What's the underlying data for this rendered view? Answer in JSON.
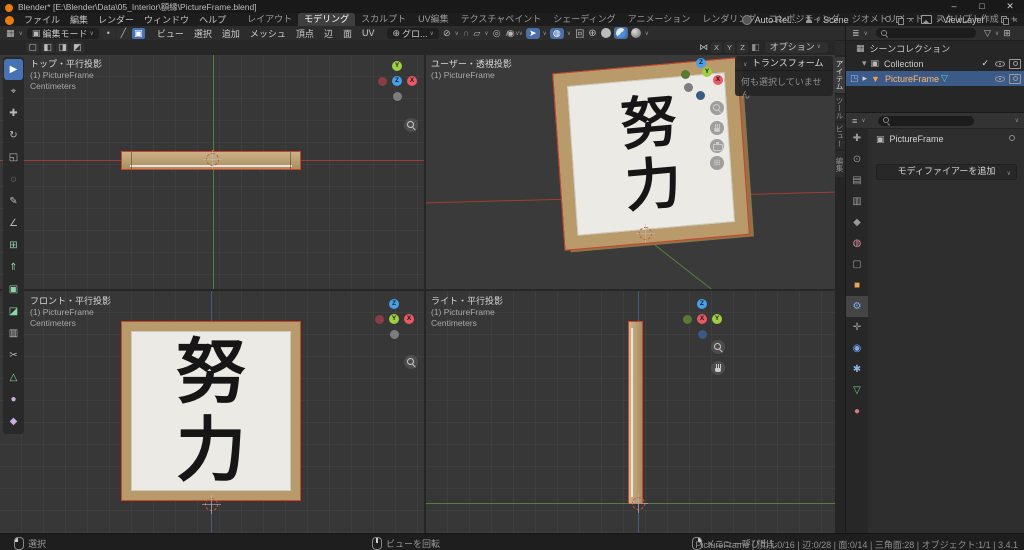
{
  "window": {
    "title": "Blender* [E:\\Blender\\Data\\05_Interior\\額縁\\PictureFrame.blend]",
    "minimize": "–",
    "maximize": "□",
    "close": "✕"
  },
  "topbar": {
    "menus": [
      "ファイル",
      "編集",
      "レンダー",
      "ウィンドウ",
      "ヘルプ"
    ],
    "workspaces": [
      "レイアウト",
      "モデリング",
      "スカルプト",
      "UV編集",
      "テクスチャペイント",
      "シェーディング",
      "アニメーション",
      "レンダリング",
      "コンポジティング",
      "ジオメトリノード",
      "スクリプト作成"
    ],
    "active_workspace": "モデリング",
    "add_workspace": "+",
    "auto_pack": "Auto Rel...",
    "scene": "Scene",
    "view_layer": "ViewLayer"
  },
  "tool_header": {
    "mode": "編集モード",
    "menus": [
      "ビュー",
      "選択",
      "追加",
      "メッシュ",
      "頂点",
      "辺",
      "面",
      "UV"
    ],
    "orientation": "グロ...",
    "mirror": [
      "X",
      "Y",
      "Z"
    ],
    "options": "オプション"
  },
  "viewports": {
    "top": {
      "label": "トップ・平行投影",
      "object": "(1) PictureFrame",
      "units": "Centimeters"
    },
    "user": {
      "label": "ユーザー・透視投影",
      "object": "(1) PictureFrame"
    },
    "front": {
      "label": "フロント・平行投影",
      "object": "(1) PictureFrame",
      "units": "Centimeters"
    },
    "right": {
      "label": "ライト・平行投影",
      "object": "(1) PictureFrame",
      "units": "Centimeters"
    }
  },
  "sidebar_tabs": [
    "アイテム",
    "ツール",
    "ビュー",
    "編集"
  ],
  "transform_panel": {
    "title": "トランスフォーム",
    "empty_message": "何も選択していません"
  },
  "artwork": {
    "kanji": [
      "努",
      "力"
    ]
  },
  "axes": {
    "x": "X",
    "y": "Y",
    "z": "Z"
  },
  "outliner": {
    "scene_collection": "シーンコレクション",
    "collection": "Collection",
    "object": "PictureFrame"
  },
  "properties": {
    "object_name": "PictureFrame",
    "add_modifier": "モディファイアーを追加"
  },
  "statusbar": {
    "hints": [
      {
        "label": "選択"
      },
      {
        "label": "ビューを回転"
      },
      {
        "label": "メニュー呼び出し"
      }
    ],
    "stats": "PictureFrame | 頂点:0/16 | 辺:0/28 | 面:0/14 | 三角面:28 | オブジェクト:1/1 | 3.4.1"
  },
  "icons": {
    "chevron": "∨",
    "editor_viewport": "▦",
    "editor_outliner": "≣",
    "editor_properties": "≡",
    "mode_cube": "▣",
    "vertex": "•",
    "edge": "╱",
    "face": "▣",
    "orientation": "⊕",
    "pivot": "⊘",
    "magnet": "∩",
    "snap_to": "▱",
    "proportional": "◎",
    "falloff": "∧",
    "gizmo_vis": "◉",
    "gizmo": "➤",
    "overlays": "◍",
    "xray": "回",
    "wire": "⊕",
    "mirror_fly": "⋈",
    "snap2": "◧",
    "tweak_modes": [
      "▢",
      "◧",
      "◨",
      "◩"
    ],
    "funnel": "▽",
    "grid_btn": "⊞",
    "plus_box": "⊞",
    "scene_coll": "▦",
    "collection": "▣",
    "mesh_obj": "▼",
    "mesh_data": "▽",
    "check": "✓",
    "arrow_r": "▸",
    "arrow_d": "▾",
    "editmode_dot": "◳",
    "toolbar_glyphs": [
      "▶",
      "⌖",
      "✚",
      "↻",
      "◱",
      "◌",
      "✎",
      "∠",
      "⊞",
      "⇑",
      "▣",
      "◪",
      "▥",
      "✂",
      "△",
      "●",
      "◆"
    ],
    "prop_tabs": [
      "✚",
      "⊙",
      "▤",
      "▥",
      "◆",
      "◍",
      "▢",
      "■",
      "⚙",
      "✛",
      "◉",
      "✱",
      "▽",
      "●"
    ]
  },
  "colors": {
    "accent": "#4772b3",
    "selection_outline": "#d0422a",
    "wood": "#b99a6b",
    "paper": "#eceae4",
    "axis_x": "#a33c36",
    "axis_y": "#55803c",
    "axis_z": "#4a5b82"
  }
}
